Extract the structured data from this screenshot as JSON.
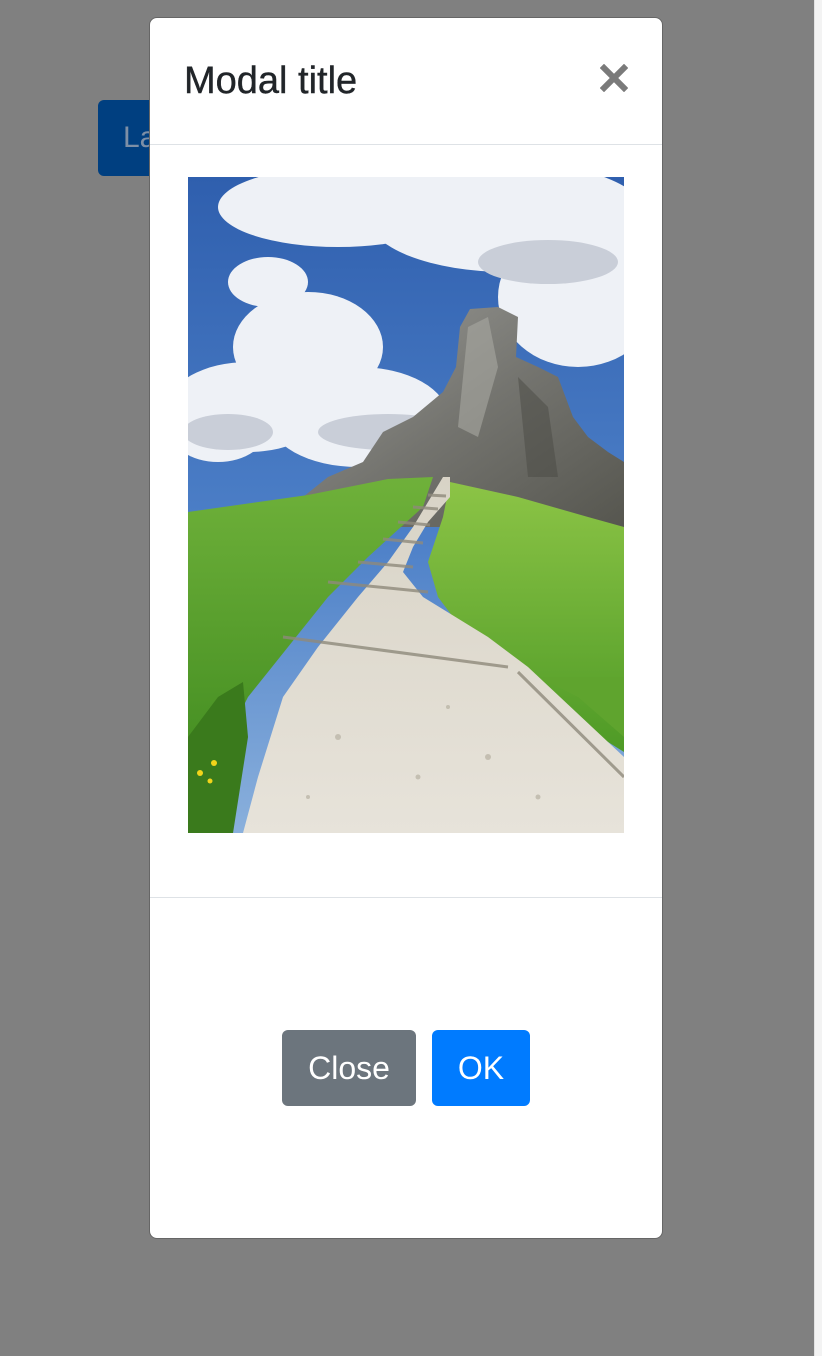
{
  "page": {
    "launch_button_label": "Launch demo modal"
  },
  "modal": {
    "title": "Modal title",
    "close_icon": "close-icon",
    "image": {
      "subject": "mountain-trail-photo"
    },
    "footer": {
      "close_label": "Close",
      "ok_label": "OK"
    }
  },
  "colors": {
    "backdrop": "#808080",
    "launch_button": "#003f80",
    "secondary_button": "#6c757d",
    "primary_button": "#007bff",
    "title_text": "#212529",
    "close_icon": "#7a7a7a"
  }
}
